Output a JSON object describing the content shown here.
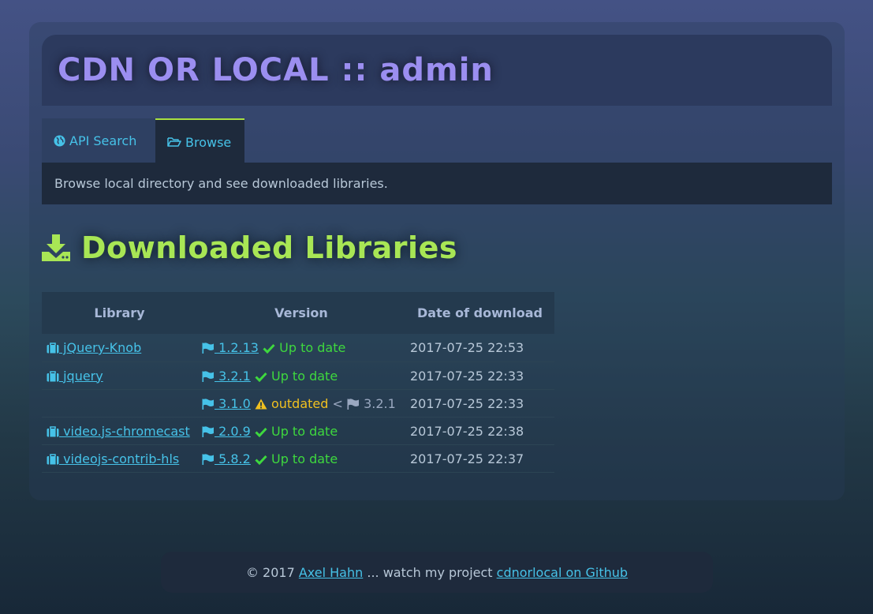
{
  "header": {
    "title": "CDN OR LOCAL :: admin"
  },
  "tabs": [
    {
      "label": "API Search",
      "icon": "globe-icon",
      "active": false
    },
    {
      "label": "Browse",
      "icon": "folder-open-icon",
      "active": true
    }
  ],
  "info": {
    "text": "Browse local directory and see downloaded libraries."
  },
  "section": {
    "title": "Downloaded Libraries",
    "icon": "download-icon"
  },
  "table": {
    "headers": [
      "Library",
      "Version",
      "Date of download"
    ],
    "rows": [
      {
        "library": " jQuery-Knob",
        "version": " 1.2.13",
        "status": " Up to date",
        "date": "2017-07-25 22:53"
      },
      {
        "library": " jquery",
        "version": " 3.2.1",
        "status": " Up to date",
        "date": "2017-07-25 22:33"
      },
      {
        "library": "",
        "version": " 3.1.0",
        "status": " outdated",
        "lt": " < ",
        "latest": " 3.2.1",
        "date": "2017-07-25 22:33"
      },
      {
        "library": " video.js-chromecast",
        "version": " 2.0.9",
        "status": " Up to date",
        "date": "2017-07-25 22:38"
      },
      {
        "library": " videojs-contrib-hls",
        "version": " 5.8.2",
        "status": " Up to date",
        "date": "2017-07-25 22:37"
      }
    ]
  },
  "footer": {
    "prefix": "© 2017 ",
    "author": "Axel Hahn",
    "middle": " ... watch my project ",
    "project": "cdnorlocal on Github"
  },
  "colors": {
    "title": "#9b8ef0",
    "accent_green": "#a8e655",
    "link": "#46c2e8",
    "ok": "#3ed83e",
    "warn": "#f0c020"
  }
}
